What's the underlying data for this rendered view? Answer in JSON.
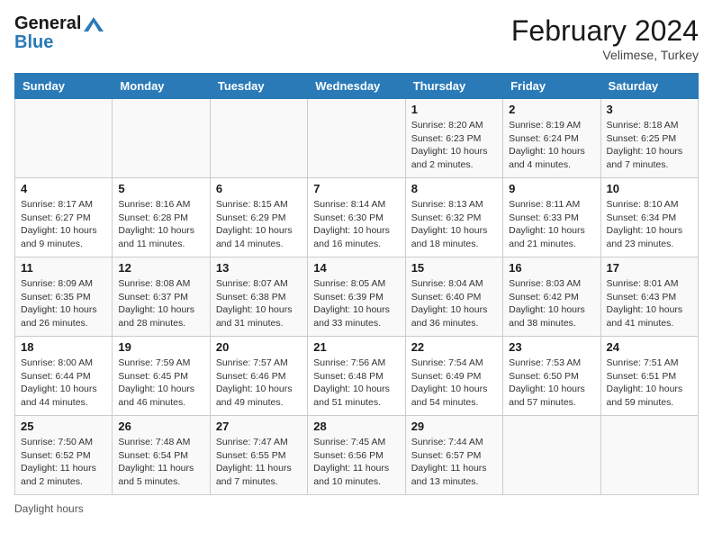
{
  "header": {
    "logo_line1": "General",
    "logo_line2": "Blue",
    "month_year": "February 2024",
    "location": "Velimese, Turkey"
  },
  "days_of_week": [
    "Sunday",
    "Monday",
    "Tuesday",
    "Wednesday",
    "Thursday",
    "Friday",
    "Saturday"
  ],
  "weeks": [
    [
      {
        "day": "",
        "info": ""
      },
      {
        "day": "",
        "info": ""
      },
      {
        "day": "",
        "info": ""
      },
      {
        "day": "",
        "info": ""
      },
      {
        "day": "1",
        "info": "Sunrise: 8:20 AM\nSunset: 6:23 PM\nDaylight: 10 hours\nand 2 minutes."
      },
      {
        "day": "2",
        "info": "Sunrise: 8:19 AM\nSunset: 6:24 PM\nDaylight: 10 hours\nand 4 minutes."
      },
      {
        "day": "3",
        "info": "Sunrise: 8:18 AM\nSunset: 6:25 PM\nDaylight: 10 hours\nand 7 minutes."
      }
    ],
    [
      {
        "day": "4",
        "info": "Sunrise: 8:17 AM\nSunset: 6:27 PM\nDaylight: 10 hours\nand 9 minutes."
      },
      {
        "day": "5",
        "info": "Sunrise: 8:16 AM\nSunset: 6:28 PM\nDaylight: 10 hours\nand 11 minutes."
      },
      {
        "day": "6",
        "info": "Sunrise: 8:15 AM\nSunset: 6:29 PM\nDaylight: 10 hours\nand 14 minutes."
      },
      {
        "day": "7",
        "info": "Sunrise: 8:14 AM\nSunset: 6:30 PM\nDaylight: 10 hours\nand 16 minutes."
      },
      {
        "day": "8",
        "info": "Sunrise: 8:13 AM\nSunset: 6:32 PM\nDaylight: 10 hours\nand 18 minutes."
      },
      {
        "day": "9",
        "info": "Sunrise: 8:11 AM\nSunset: 6:33 PM\nDaylight: 10 hours\nand 21 minutes."
      },
      {
        "day": "10",
        "info": "Sunrise: 8:10 AM\nSunset: 6:34 PM\nDaylight: 10 hours\nand 23 minutes."
      }
    ],
    [
      {
        "day": "11",
        "info": "Sunrise: 8:09 AM\nSunset: 6:35 PM\nDaylight: 10 hours\nand 26 minutes."
      },
      {
        "day": "12",
        "info": "Sunrise: 8:08 AM\nSunset: 6:37 PM\nDaylight: 10 hours\nand 28 minutes."
      },
      {
        "day": "13",
        "info": "Sunrise: 8:07 AM\nSunset: 6:38 PM\nDaylight: 10 hours\nand 31 minutes."
      },
      {
        "day": "14",
        "info": "Sunrise: 8:05 AM\nSunset: 6:39 PM\nDaylight: 10 hours\nand 33 minutes."
      },
      {
        "day": "15",
        "info": "Sunrise: 8:04 AM\nSunset: 6:40 PM\nDaylight: 10 hours\nand 36 minutes."
      },
      {
        "day": "16",
        "info": "Sunrise: 8:03 AM\nSunset: 6:42 PM\nDaylight: 10 hours\nand 38 minutes."
      },
      {
        "day": "17",
        "info": "Sunrise: 8:01 AM\nSunset: 6:43 PM\nDaylight: 10 hours\nand 41 minutes."
      }
    ],
    [
      {
        "day": "18",
        "info": "Sunrise: 8:00 AM\nSunset: 6:44 PM\nDaylight: 10 hours\nand 44 minutes."
      },
      {
        "day": "19",
        "info": "Sunrise: 7:59 AM\nSunset: 6:45 PM\nDaylight: 10 hours\nand 46 minutes."
      },
      {
        "day": "20",
        "info": "Sunrise: 7:57 AM\nSunset: 6:46 PM\nDaylight: 10 hours\nand 49 minutes."
      },
      {
        "day": "21",
        "info": "Sunrise: 7:56 AM\nSunset: 6:48 PM\nDaylight: 10 hours\nand 51 minutes."
      },
      {
        "day": "22",
        "info": "Sunrise: 7:54 AM\nSunset: 6:49 PM\nDaylight: 10 hours\nand 54 minutes."
      },
      {
        "day": "23",
        "info": "Sunrise: 7:53 AM\nSunset: 6:50 PM\nDaylight: 10 hours\nand 57 minutes."
      },
      {
        "day": "24",
        "info": "Sunrise: 7:51 AM\nSunset: 6:51 PM\nDaylight: 10 hours\nand 59 minutes."
      }
    ],
    [
      {
        "day": "25",
        "info": "Sunrise: 7:50 AM\nSunset: 6:52 PM\nDaylight: 11 hours\nand 2 minutes."
      },
      {
        "day": "26",
        "info": "Sunrise: 7:48 AM\nSunset: 6:54 PM\nDaylight: 11 hours\nand 5 minutes."
      },
      {
        "day": "27",
        "info": "Sunrise: 7:47 AM\nSunset: 6:55 PM\nDaylight: 11 hours\nand 7 minutes."
      },
      {
        "day": "28",
        "info": "Sunrise: 7:45 AM\nSunset: 6:56 PM\nDaylight: 11 hours\nand 10 minutes."
      },
      {
        "day": "29",
        "info": "Sunrise: 7:44 AM\nSunset: 6:57 PM\nDaylight: 11 hours\nand 13 minutes."
      },
      {
        "day": "",
        "info": ""
      },
      {
        "day": "",
        "info": ""
      }
    ]
  ],
  "footer": {
    "daylight_hours_label": "Daylight hours"
  }
}
